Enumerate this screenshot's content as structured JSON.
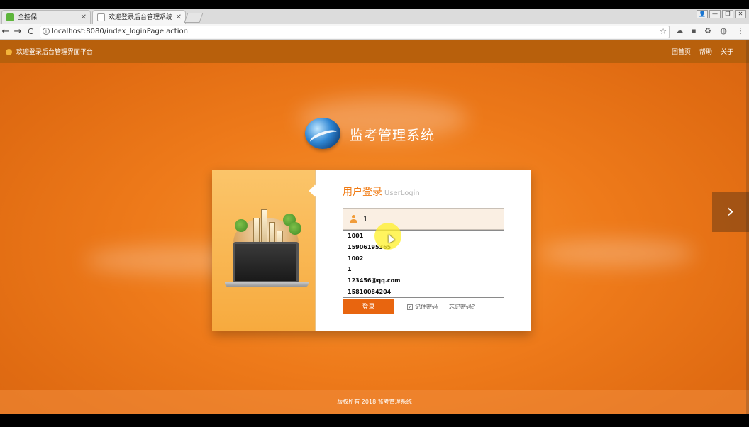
{
  "browser": {
    "tabs": [
      {
        "label": "全控保",
        "favicon_color": "#5db53b"
      },
      {
        "label": "欢迎登录后台管理系统",
        "favicon_color": "#cfcfcf"
      }
    ],
    "nav": {
      "back": "←",
      "forward": "→",
      "reload": "C"
    },
    "url": "localhost:8080/index_loginPage.action",
    "window_buttons": [
      "👤",
      "—",
      "❐",
      "✕"
    ],
    "extensions": [
      "☁",
      "▪",
      "♻",
      "◍",
      "⋮"
    ]
  },
  "header": {
    "welcome": "欢迎登录后台管理界面平台",
    "links": [
      "回首页",
      "帮助",
      "关于"
    ]
  },
  "brand": {
    "title": "监考管理系统"
  },
  "login": {
    "title": "用户登录",
    "subtitle": "UserLogin",
    "username_value": "1",
    "suggestions": [
      "1001",
      "15906195365",
      "1002",
      "1",
      "123456@qq.com",
      "15810084204"
    ],
    "submit_label": "登录",
    "remember_label": "记住密码",
    "remember_checked": true,
    "forgot_label": "忘记密码？"
  },
  "carousel": {
    "next": "›"
  },
  "footer": {
    "copyright": "版权所有 2018 监考管理系统"
  },
  "colors": {
    "accent": "#e8650f",
    "topbar": "#b8600c",
    "title": "#f07a12"
  }
}
